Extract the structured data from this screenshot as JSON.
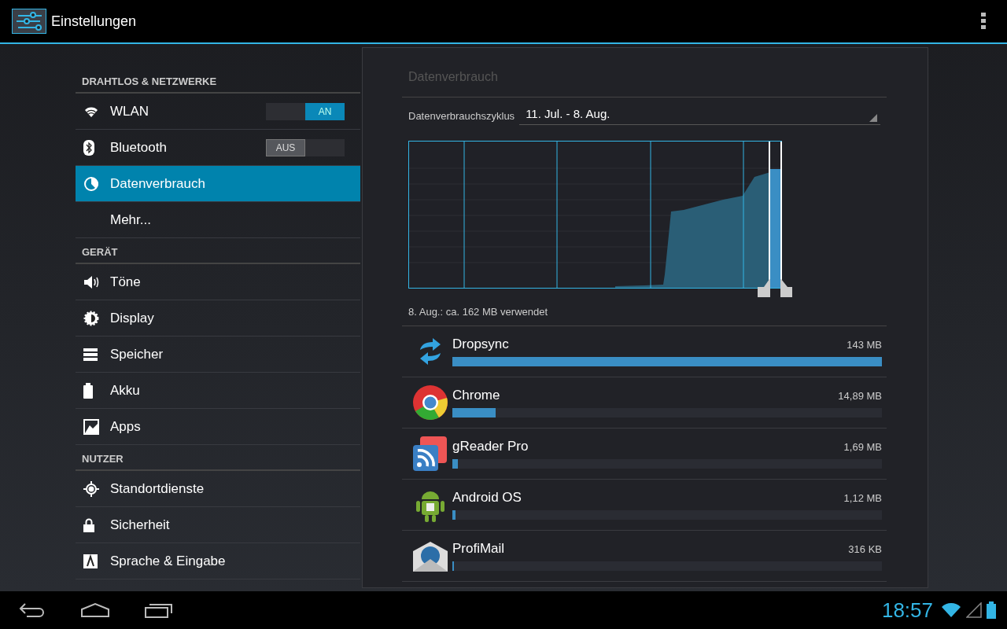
{
  "action_bar": {
    "title": "Einstellungen"
  },
  "sidebar": {
    "sections": [
      {
        "header": "DRAHTLOS & NETZWERKE",
        "items": [
          {
            "label": "WLAN",
            "kind": "toggle",
            "on": true,
            "toggle_label": "AN",
            "selected": false
          },
          {
            "label": "Bluetooth",
            "kind": "toggle",
            "on": false,
            "toggle_label": "AUS",
            "selected": false
          },
          {
            "label": "Datenverbrauch",
            "kind": "plain",
            "selected": true
          },
          {
            "label": "Mehr...",
            "kind": "plain",
            "selected": false
          }
        ]
      },
      {
        "header": "GERÄT",
        "items": [
          {
            "label": "Töne",
            "kind": "plain",
            "selected": false
          },
          {
            "label": "Display",
            "kind": "plain",
            "selected": false
          },
          {
            "label": "Speicher",
            "kind": "plain",
            "selected": false
          },
          {
            "label": "Akku",
            "kind": "plain",
            "selected": false
          },
          {
            "label": "Apps",
            "kind": "plain",
            "selected": false
          }
        ]
      },
      {
        "header": "NUTZER",
        "items": [
          {
            "label": "Standortdienste",
            "kind": "plain",
            "selected": false
          },
          {
            "label": "Sicherheit",
            "kind": "plain",
            "selected": false
          },
          {
            "label": "Sprache & Eingabe",
            "kind": "plain",
            "selected": false
          }
        ]
      }
    ]
  },
  "detail": {
    "title": "Datenverbrauch",
    "cycle_label": "Datenverbrauchszyklus",
    "cycle_value": "11. Jul. - 8. Aug.",
    "summary": "8. Aug.: ca. 162 MB verwendet",
    "apps": [
      {
        "name": "Dropsync",
        "amount": "143 MB",
        "level": 1.0
      },
      {
        "name": "Chrome",
        "amount": "14,89 MB",
        "level": 0.1
      },
      {
        "name": "gReader Pro",
        "amount": "1,69 MB",
        "level": 0.012
      },
      {
        "name": "Android OS",
        "amount": "1,12 MB",
        "level": 0.008
      },
      {
        "name": "ProfiMail",
        "amount": "316 KB",
        "level": 0.002
      }
    ]
  },
  "status_bar": {
    "time": "18:57"
  }
}
